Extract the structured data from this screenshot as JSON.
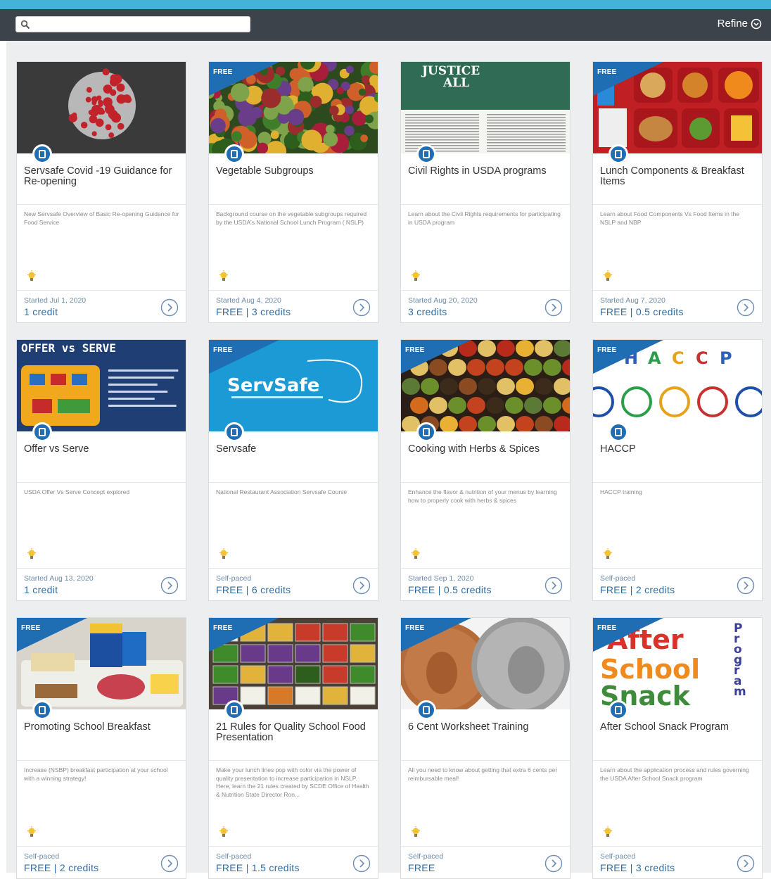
{
  "search": {
    "placeholder": "",
    "value": ""
  },
  "toolbar": {
    "refine_label": "Refine"
  },
  "colors": {
    "accent": "#1f6db3",
    "toolbar": "#3d434a",
    "stripe": "#44b3d9"
  },
  "courses": [
    {
      "free": false,
      "free_label": "",
      "title": "Servsafe Covid -19 Guidance for Re-opening",
      "description": "New Servsafe Overview of Basic Re-opening Guidance for Food Service",
      "started": "Started Jul 1, 2020",
      "price": "1 credit",
      "image": "covid-virus"
    },
    {
      "free": true,
      "free_label": "FREE",
      "title": "Vegetable Subgroups",
      "description": "Background course on the vegetable subgroups required by the USDA's National School Lunch Program ( NSLP)",
      "started": "Started Aug 4, 2020",
      "price": "FREE | 3 credits",
      "image": "vegetables"
    },
    {
      "free": false,
      "free_label": "",
      "title": "Civil Rights in USDA programs",
      "description": "Learn about the Civil Rights requirements for participating in USDA program",
      "started": "Started Aug 20, 2020",
      "price": "3 credits",
      "image": "justice-for-all",
      "image_text": "AND JUSTICE FOR ALL"
    },
    {
      "free": true,
      "free_label": "FREE",
      "title": "Lunch Components & Breakfast Items",
      "description": "Learn about Food Components Vs Food Items in the NSLP and NBP",
      "started": "Started Aug 7, 2020",
      "price": "FREE | 0.5 credits",
      "image": "lunch-tray"
    },
    {
      "free": false,
      "free_label": "",
      "title": "Offer vs Serve",
      "description": "USDA Offer Vs Serve Concept explored",
      "started": "Started Aug 13, 2020",
      "price": "1 credit",
      "image": "offer-vs-serve",
      "image_text": "OFFER vs SERVE"
    },
    {
      "free": true,
      "free_label": "FREE",
      "title": "Servsafe",
      "description": "National Restaurant Association Servsafe Course",
      "started": "Self-paced",
      "price": "FREE | 6 credits",
      "image": "servsafe-logo",
      "image_text": "ServSafe"
    },
    {
      "free": true,
      "free_label": "FREE",
      "title": "Cooking with Herbs & Spices",
      "description": "Enhance the flavor & nutrition of your menus by learning how to properly cook with herbs & spices",
      "started": "Started Sep 1, 2020",
      "price": "FREE | 0.5 credits",
      "image": "spices"
    },
    {
      "free": true,
      "free_label": "FREE",
      "title": "HACCP",
      "description": "HACCP training",
      "started": "Self-paced",
      "price": "FREE | 2 credits",
      "image": "haccp",
      "image_text": "HACCP"
    },
    {
      "free": true,
      "free_label": "FREE",
      "title": "Promoting School Breakfast",
      "description": "Increase (NSBP) breakfast participation at your school with a winning strategy!",
      "started": "Self-paced",
      "price": "FREE | 2 credits",
      "image": "breakfast-tray"
    },
    {
      "free": true,
      "free_label": "FREE",
      "title": "21 Rules for Quality School Food Presentation",
      "description": "Make your lunch lines pop with color via the power of quality presentation to increase participation in NSLP. Here, learn the 21 rules created by SCDE Office of Health & Nutrition State Director Ron...",
      "started": "Self-paced",
      "price": "FREE | 1.5 credits",
      "image": "salad-bar"
    },
    {
      "free": true,
      "free_label": "FREE",
      "title": "6 Cent Worksheet Training",
      "description": "All you need to know about getting that extra 6 cents per reimbursable meal!",
      "started": "Self-paced",
      "price": "FREE",
      "image": "coins"
    },
    {
      "free": true,
      "free_label": "FREE",
      "title": "After School Snack Program",
      "description": "Learn about the application process and rules governing the USDA After School Snack program",
      "started": "Self-paced",
      "price": "FREE | 3 credits",
      "image": "after-school-snack",
      "image_text": "After School Snack Program"
    }
  ]
}
